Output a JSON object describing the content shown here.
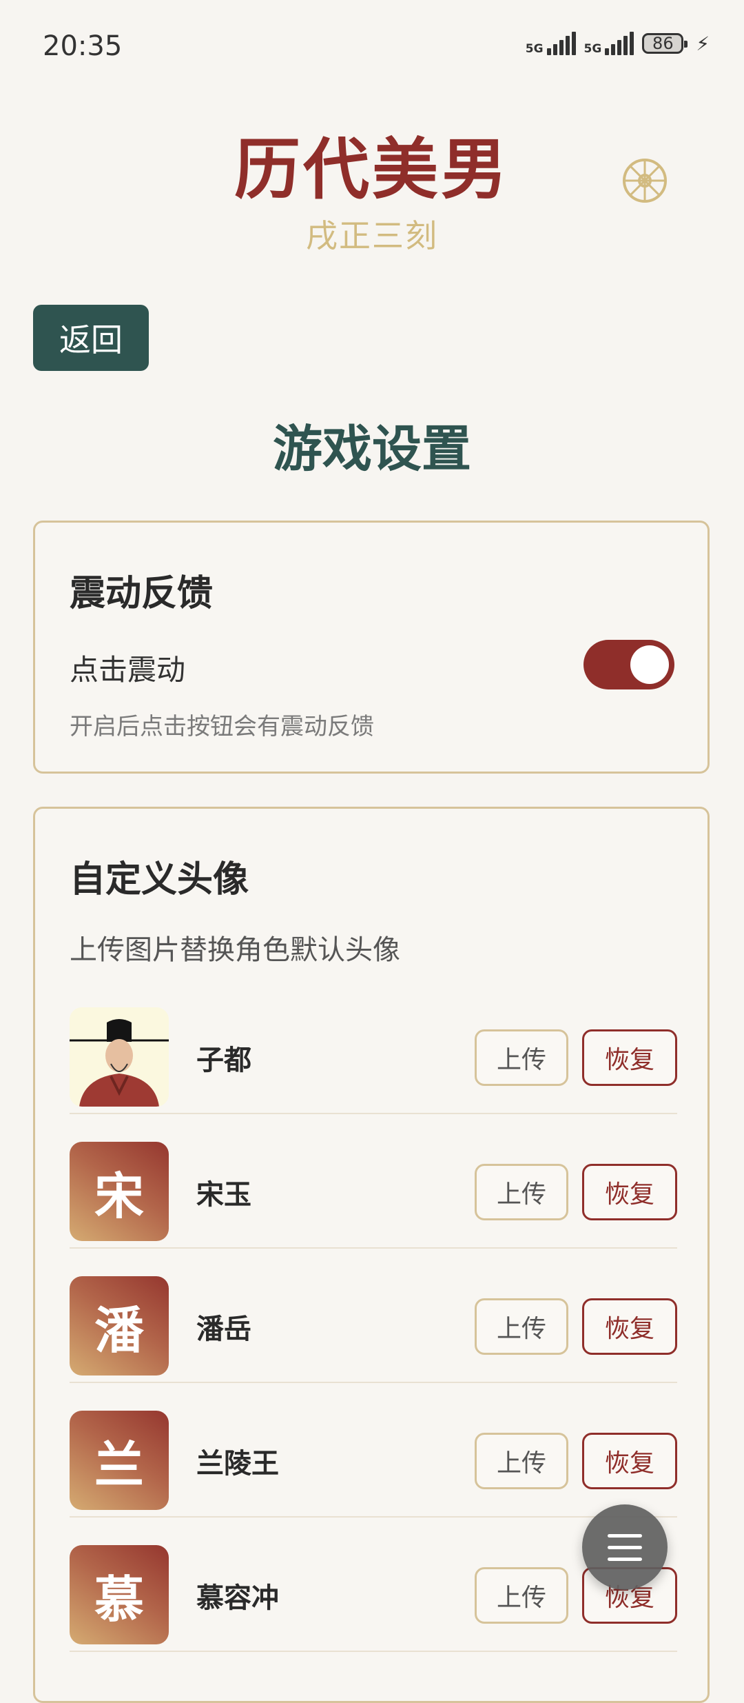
{
  "status_bar": {
    "time": "20:35",
    "signal_1_label": "5G",
    "signal_2_label": "5G",
    "battery": "86"
  },
  "header": {
    "app_title": "历代美男",
    "subtitle": "戌正三刻",
    "icon": "dharma-wheel-icon"
  },
  "nav": {
    "back_label": "返回"
  },
  "page_title": "游戏设置",
  "vibration": {
    "title": "震动反馈",
    "toggle_label": "点击震动",
    "toggle_on": true,
    "description": "开启后点击按钮会有震动反馈"
  },
  "avatars": {
    "title": "自定义头像",
    "description": "上传图片替换角色默认头像",
    "upload_label": "上传",
    "restore_label": "恢复",
    "items": [
      {
        "name": "子都",
        "avatar_char": "",
        "avatar_type": "portrait"
      },
      {
        "name": "宋玉",
        "avatar_char": "宋",
        "avatar_type": "letter"
      },
      {
        "name": "潘岳",
        "avatar_char": "潘",
        "avatar_type": "letter"
      },
      {
        "name": "兰陵王",
        "avatar_char": "兰",
        "avatar_type": "letter"
      },
      {
        "name": "慕容冲",
        "avatar_char": "慕",
        "avatar_type": "letter"
      }
    ]
  },
  "colors": {
    "accent_red": "#8f2e2a",
    "accent_green": "#2f5450",
    "gold": "#d2bb80",
    "background": "#f7f5f1"
  },
  "fab": {
    "icon": "menu-icon"
  }
}
